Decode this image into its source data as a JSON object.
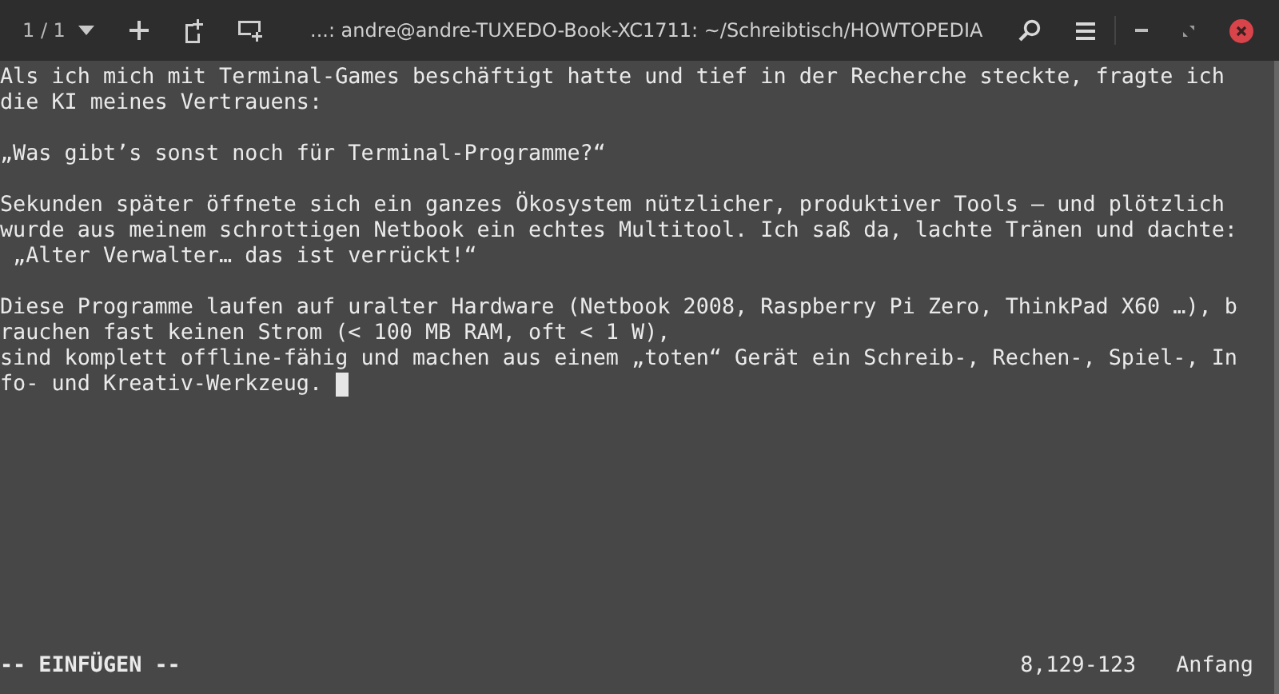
{
  "window": {
    "title": "...: andre@andre-TUXEDO-Book-XC1711: ~/Schreibtisch/HOWTOPEDIA",
    "tab_counter": "1 / 1"
  },
  "editor": {
    "paragraphs": [
      [
        "Als ich mich mit Terminal-Games beschäftigt hatte und tief in der Recherche steckte, fragte ich",
        "die KI meines Vertrauens:"
      ],
      [
        "„Was gibt’s sonst noch für Terminal-Programme?“"
      ],
      [
        "Sekunden später öffnete sich ein ganzes Ökosystem nützlicher, produktiver Tools – und plötzlich",
        "wurde aus meinem schrottigen Netbook ein echtes Multitool. Ich saß da, lachte Tränen und dachte:",
        " „Alter Verwalter… das ist verrückt!“"
      ],
      [
        "Diese Programme laufen auf uralter Hardware (Netbook 2008, Raspberry Pi Zero, ThinkPad X60 …), b",
        "rauchen fast keinen Strom (< 100 MB RAM, oft < 1 W),",
        "sind komplett offline-fähig und machen aus einem „toten“ Gerät ein Schreib-, Rechen-, Spiel-, In",
        "fo- und Kreativ-Werkzeug."
      ]
    ],
    "cursor": true
  },
  "status_bar": {
    "mode": "-- EINFÜGEN --",
    "position": "8,129-123",
    "scroll": "Anfang"
  }
}
